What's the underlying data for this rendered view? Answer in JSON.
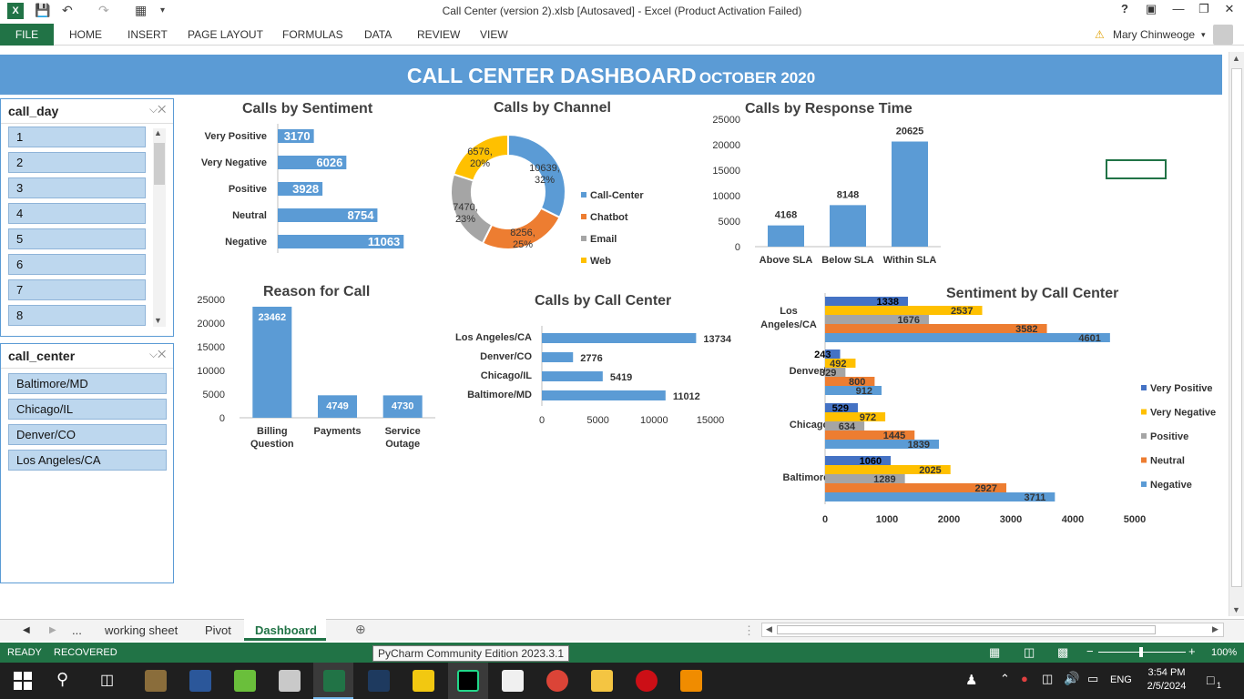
{
  "window": {
    "title": "Call Center (version 2).xlsb [Autosaved] - Excel (Product Activation Failed)",
    "help": "?",
    "user": "Mary Chinweoge"
  },
  "ribbon": {
    "tabs": [
      "FILE",
      "HOME",
      "INSERT",
      "PAGE LAYOUT",
      "FORMULAS",
      "DATA",
      "REVIEW",
      "VIEW"
    ]
  },
  "banner": {
    "title": "CALL CENTER DASHBOARD",
    "subtitle": "OCTOBER 2020"
  },
  "slicers": {
    "call_day": {
      "title": "call_day",
      "items": [
        "1",
        "2",
        "3",
        "4",
        "5",
        "6",
        "7",
        "8"
      ]
    },
    "call_center": {
      "title": "call_center",
      "items": [
        "Baltimore/MD",
        "Chicago/IL",
        "Denver/CO",
        "Los Angeles/CA"
      ]
    }
  },
  "chart_data": [
    {
      "id": "sentiment",
      "type": "bar",
      "orientation": "horizontal",
      "title": "Calls by Sentiment",
      "categories": [
        "Very Positive",
        "Very Negative",
        "Positive",
        "Neutral",
        "Negative"
      ],
      "values": [
        3170,
        6026,
        3928,
        8754,
        11063
      ],
      "xlim": [
        0,
        12000
      ],
      "color": "#5b9bd5"
    },
    {
      "id": "channel",
      "type": "pie",
      "title": "Calls by Channel",
      "categories": [
        "Call-Center",
        "Chatbot",
        "Email",
        "Web"
      ],
      "values": [
        10639,
        8256,
        7470,
        6576
      ],
      "labels": [
        "10639, 32%",
        "8256, 25%",
        "7470, 23%",
        "6576, 20%"
      ],
      "colors": [
        "#5b9bd5",
        "#ed7d31",
        "#a5a5a5",
        "#ffc000"
      ],
      "legend": "right"
    },
    {
      "id": "response",
      "type": "bar",
      "title": "Calls by Response Time",
      "categories": [
        "Above SLA",
        "Below SLA",
        "Within SLA"
      ],
      "values": [
        4168,
        8148,
        20625
      ],
      "ylim": [
        0,
        25000
      ],
      "yticks": [
        0,
        5000,
        10000,
        15000,
        20000,
        25000
      ],
      "color": "#5b9bd5"
    },
    {
      "id": "reason",
      "type": "bar",
      "title": "Reason for Call",
      "categories": [
        "Billing Question",
        "Payments",
        "Service Outage"
      ],
      "values": [
        23462,
        4749,
        4730
      ],
      "ylim": [
        0,
        25000
      ],
      "yticks": [
        0,
        5000,
        10000,
        15000,
        20000,
        25000
      ],
      "color": "#5b9bd5"
    },
    {
      "id": "callcenter",
      "type": "bar",
      "orientation": "horizontal",
      "title": "Calls by Call Center",
      "categories": [
        "Los Angeles/CA",
        "Denver/CO",
        "Chicago/IL",
        "Baltimore/MD"
      ],
      "values": [
        13734,
        2776,
        5419,
        11012
      ],
      "xlim": [
        0,
        15000
      ],
      "xticks": [
        0,
        5000,
        10000,
        15000
      ],
      "color": "#5b9bd5"
    },
    {
      "id": "sentcenter",
      "type": "bar",
      "orientation": "horizontal",
      "title": "Sentiment by Call Center",
      "categories": [
        "Los Angeles/CA",
        "Denver/CO",
        "Chicago/IL",
        "Baltimore/MD"
      ],
      "series": [
        {
          "name": "Very Positive",
          "color": "#4472c4",
          "values": [
            1338,
            243,
            529,
            1060
          ]
        },
        {
          "name": "Very Negative",
          "color": "#ffc000",
          "values": [
            2537,
            492,
            972,
            2025
          ]
        },
        {
          "name": "Positive",
          "color": "#a5a5a5",
          "values": [
            1676,
            329,
            634,
            1289
          ]
        },
        {
          "name": "Neutral",
          "color": "#ed7d31",
          "values": [
            3582,
            800,
            1445,
            2927
          ]
        },
        {
          "name": "Negative",
          "color": "#5b9bd5",
          "values": [
            4601,
            912,
            1839,
            3711
          ]
        }
      ],
      "xlim": [
        0,
        5000
      ],
      "xticks": [
        0,
        1000,
        2000,
        3000,
        4000,
        5000
      ],
      "legend": "right"
    }
  ],
  "sheet_tabs": {
    "more": "...",
    "tabs": [
      "working sheet",
      "Pivot",
      "Dashboard"
    ],
    "active": "Dashboard"
  },
  "status": {
    "ready": "READY",
    "recovered": "RECOVERED",
    "zoom": "100%"
  },
  "tooltip": "PyCharm Community Edition 2023.3.1",
  "taskbar": {
    "time": "3:54 PM",
    "date": "2/5/2024",
    "lang": "ENG",
    "notifications": "1"
  }
}
